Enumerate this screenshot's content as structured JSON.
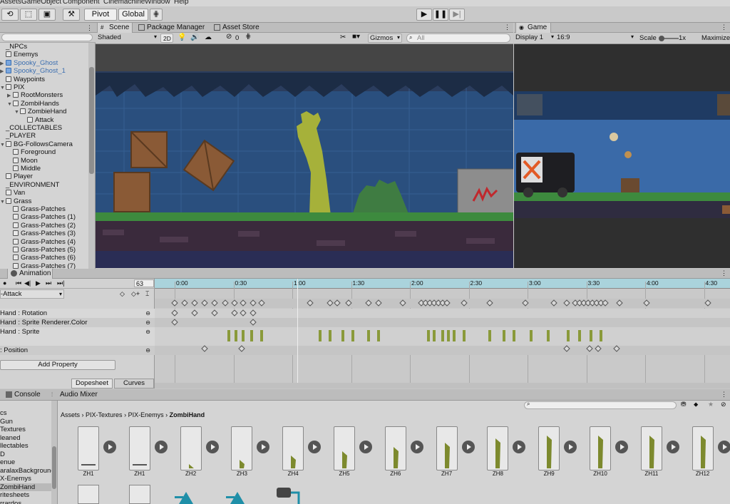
{
  "menu": [
    "Assets",
    "GameObject",
    "Component",
    "Cinemachine",
    "Window",
    "Help"
  ],
  "toolbar": {
    "pivot": "Pivot",
    "global": "Global"
  },
  "scene_tabs": [
    "Scene",
    "Package Manager",
    "Asset Store"
  ],
  "game_tab": "Game",
  "scene_bar": {
    "shading": "Shaded",
    "mode2d": "2D",
    "gizmo_count": "0",
    "gizmos": "Gizmos",
    "search_placeholder": "All"
  },
  "game_bar": {
    "display": "Display 1",
    "aspect": "16:9",
    "scale_label": "Scale",
    "scale_value": "1x",
    "maximize": "Maximize"
  },
  "hierarchy": [
    {
      "label": "_NPCs",
      "indent": 0,
      "blue": false,
      "cube": false,
      "arrow": ""
    },
    {
      "label": "Enemys",
      "indent": 0,
      "blue": false,
      "cube": true,
      "arrow": ""
    },
    {
      "label": "Spooky_Ghost",
      "indent": 0,
      "blue": true,
      "cube": true,
      "arrow": "▶"
    },
    {
      "label": "Spooky_Ghost_1",
      "indent": 0,
      "blue": true,
      "cube": true,
      "arrow": "▶"
    },
    {
      "label": "Waypoints",
      "indent": 0,
      "blue": false,
      "cube": true,
      "arrow": ""
    },
    {
      "label": "PIX",
      "indent": 0,
      "blue": false,
      "cube": true,
      "arrow": "▼"
    },
    {
      "label": "RootMonsters",
      "indent": 1,
      "blue": false,
      "cube": true,
      "arrow": "▶"
    },
    {
      "label": "ZombiHands",
      "indent": 1,
      "blue": false,
      "cube": true,
      "arrow": "▼"
    },
    {
      "label": "ZombieHand",
      "indent": 2,
      "blue": false,
      "cube": true,
      "arrow": "▼"
    },
    {
      "label": "Attack",
      "indent": 3,
      "blue": false,
      "cube": true,
      "arrow": ""
    },
    {
      "label": "_COLLECTABLES",
      "indent": 0,
      "blue": false,
      "cube": false,
      "arrow": ""
    },
    {
      "label": "_PLAYER",
      "indent": 0,
      "blue": false,
      "cube": false,
      "arrow": ""
    },
    {
      "label": "BG-FollowsCamera",
      "indent": 0,
      "blue": false,
      "cube": true,
      "arrow": "▼"
    },
    {
      "label": "Foreground",
      "indent": 1,
      "blue": false,
      "cube": true,
      "arrow": ""
    },
    {
      "label": "Moon",
      "indent": 1,
      "blue": false,
      "cube": true,
      "arrow": ""
    },
    {
      "label": "Middle",
      "indent": 1,
      "blue": false,
      "cube": true,
      "arrow": ""
    },
    {
      "label": "Player",
      "indent": 0,
      "blue": false,
      "cube": true,
      "arrow": ""
    },
    {
      "label": "_ENVIRONMENT",
      "indent": 0,
      "blue": false,
      "cube": false,
      "arrow": ""
    },
    {
      "label": "Van",
      "indent": 0,
      "blue": false,
      "cube": true,
      "arrow": ""
    },
    {
      "label": "Grass",
      "indent": 0,
      "blue": false,
      "cube": true,
      "arrow": "▼"
    },
    {
      "label": "Grass-Patches",
      "indent": 1,
      "blue": false,
      "cube": true,
      "arrow": ""
    },
    {
      "label": "Grass-Patches (1)",
      "indent": 1,
      "blue": false,
      "cube": true,
      "arrow": ""
    },
    {
      "label": "Grass-Patches (2)",
      "indent": 1,
      "blue": false,
      "cube": true,
      "arrow": ""
    },
    {
      "label": "Grass-Patches (3)",
      "indent": 1,
      "blue": false,
      "cube": true,
      "arrow": ""
    },
    {
      "label": "Grass-Patches (4)",
      "indent": 1,
      "blue": false,
      "cube": true,
      "arrow": ""
    },
    {
      "label": "Grass-Patches (5)",
      "indent": 1,
      "blue": false,
      "cube": true,
      "arrow": ""
    },
    {
      "label": "Grass-Patches (6)",
      "indent": 1,
      "blue": false,
      "cube": true,
      "arrow": ""
    },
    {
      "label": "Grass-Patches (7)",
      "indent": 1,
      "blue": false,
      "cube": true,
      "arrow": ""
    }
  ],
  "animation": {
    "tab": "Animation",
    "frame": "63",
    "clip": "-Attack",
    "add_property": "Add Property",
    "dopesheet": "Dopesheet",
    "curves": "Curves",
    "properties": [
      "Hand : Rotation",
      "Hand : Sprite Renderer.Color",
      "Hand : Sprite",
      ": Position"
    ],
    "ticks": [
      "0:00",
      "0:30",
      "1:00",
      "1:30",
      "2:00",
      "2:30",
      "3:00",
      "3:30",
      "4:00",
      "4:30"
    ]
  },
  "console_tabs": [
    "Console",
    "Audio Mixer"
  ],
  "project": {
    "tree": [
      "cs",
      "Gun",
      "Textures",
      "leaned",
      "llectables",
      "D",
      "enue",
      "aralaxBackground",
      "X-Enemys",
      "ZombiHand",
      "ritesheets",
      "rrardos"
    ],
    "selected_index": 9,
    "breadcrumb": [
      "Assets",
      "PIX-Textures",
      "PIX-Enemys",
      "ZombiHand"
    ],
    "assets": [
      "ZH1",
      "ZH1",
      "ZH2",
      "ZH3",
      "ZH4",
      "ZH5",
      "ZH6",
      "ZH7",
      "ZH8",
      "ZH9",
      "ZH10",
      "ZH11",
      "ZH12"
    ]
  },
  "colors": {
    "sky": "#2c3f62",
    "grass": "#2f6a3a",
    "crate": "#8a5a36",
    "zombie": "#a6b13a",
    "timeline_highlight": "#aad3dc"
  }
}
